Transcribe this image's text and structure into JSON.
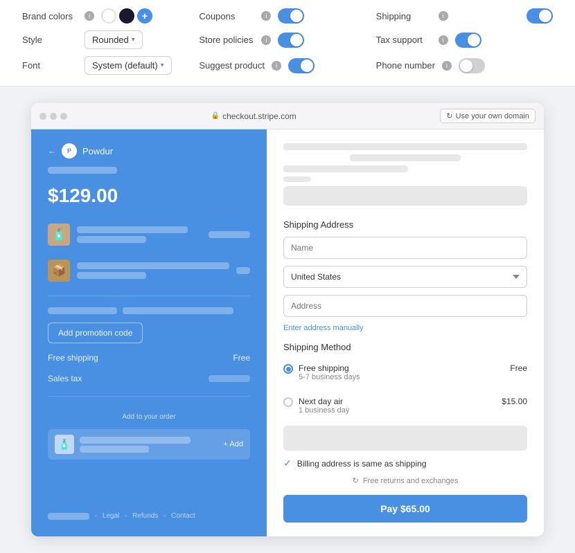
{
  "settings": {
    "brand_colors_label": "Brand colors",
    "style_label": "Style",
    "font_label": "Font",
    "coupons_label": "Coupons",
    "store_policies_label": "Store policies",
    "suggest_product_label": "Suggest product",
    "shipping_label": "Shipping",
    "tax_support_label": "Tax support",
    "phone_number_label": "Phone number",
    "style_value": "Rounded",
    "font_value": "System (default)",
    "coupons_on": true,
    "store_policies_on": true,
    "suggest_product_on": true,
    "shipping_on": true,
    "tax_support_on": true,
    "phone_number_on": false
  },
  "browser": {
    "domain": "checkout.stripe.com",
    "own_domain_btn": "Use your own domain",
    "lock_icon": "🔒"
  },
  "checkout": {
    "merchant_name": "Powdur",
    "price": "$129.00",
    "coupon_btn": "Add promotion code",
    "shipping_label": "Free shipping",
    "shipping_value": "Free",
    "sales_tax_label": "Sales tax",
    "upsell_header": "Add to your order",
    "add_btn": "+ Add",
    "footer_links": [
      "Legal",
      "Refunds",
      "Contact"
    ]
  },
  "form": {
    "shipping_address_title": "Shipping Address",
    "name_placeholder": "Name",
    "country_value": "United States",
    "address_placeholder": "Address",
    "enter_address_link": "Enter address manually",
    "shipping_method_title": "Shipping Method",
    "free_shipping_name": "Free shipping",
    "free_shipping_days": "5-7 business days",
    "free_shipping_price": "Free",
    "next_day_name": "Next day air",
    "next_day_days": "1 business day",
    "next_day_price": "$15.00",
    "billing_same": "Billing address is same as shipping",
    "free_returns": "Free returns and exchanges",
    "pay_btn": "Pay $65.00"
  }
}
